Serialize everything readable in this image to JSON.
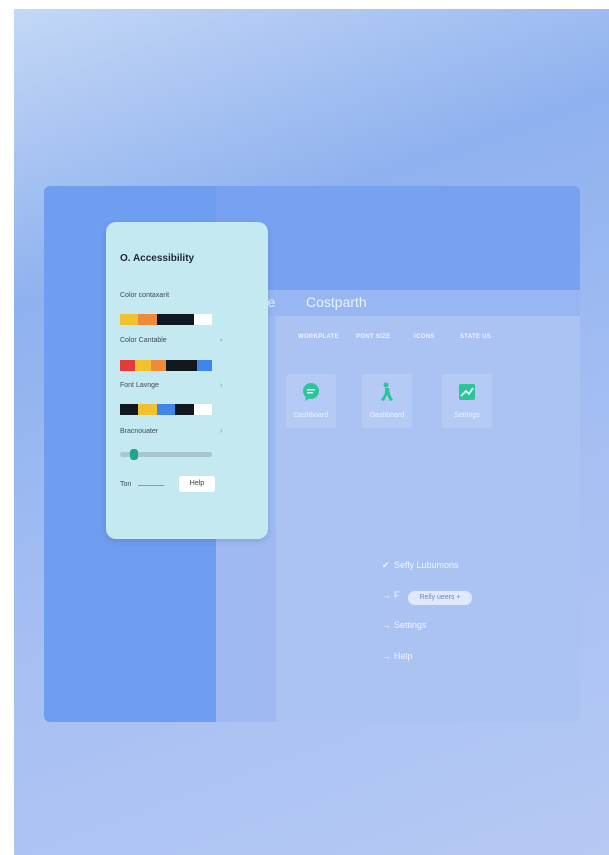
{
  "nav": {
    "links": [
      "Home",
      "Costparth"
    ]
  },
  "tabs": [
    "WORKPLATE",
    "PONT SIZE",
    "ICONS",
    "STATE US"
  ],
  "tiles": [
    {
      "label": "Dashboard",
      "icon": "chat-bubble-icon",
      "color": "#2cc59a"
    },
    {
      "label": "Dashboard",
      "icon": "person-walking-icon",
      "color": "#2cc59a"
    },
    {
      "label": "Settings",
      "icon": "chart-image-icon",
      "color": "#2cc59a"
    }
  ],
  "list": [
    {
      "mark": "✔",
      "label": "Sefly Lubumons"
    },
    {
      "mark": "→",
      "label": "F"
    },
    {
      "mark": "→",
      "label": "Settings"
    },
    {
      "mark": "→",
      "label": "Help"
    }
  ],
  "tooltip": "Relly ueers +",
  "panel": {
    "title": "O. Accessibility",
    "fields": [
      {
        "label": "Color contaxarit",
        "caret": "",
        "swatches": [
          "#f2c12e",
          "#ef8a3a",
          "#111820",
          "#111820",
          "#ffffff"
        ]
      },
      {
        "label": "Color Cantable",
        "caret": "›",
        "swatches": [
          "#e33a3a",
          "#f2c12e",
          "#ef8a3a",
          "#111820",
          "#111820",
          "#3e86e8"
        ]
      },
      {
        "label": "Font Lavnge",
        "caret": "›",
        "swatches": [
          "#111820",
          "#f2c12e",
          "#3e86e8",
          "#111820",
          "#ffffff"
        ]
      },
      {
        "label": "Bracnouater",
        "caret": "›"
      }
    ],
    "slider_value": 0.15,
    "footer_label": "Ton",
    "help_label": "Help"
  }
}
